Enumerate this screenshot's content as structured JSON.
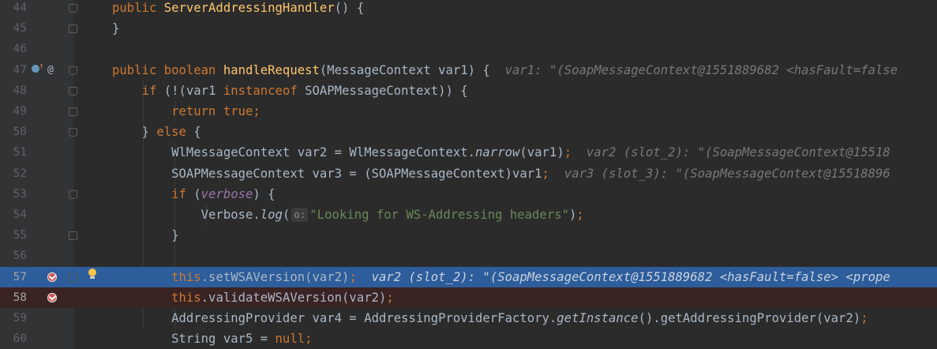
{
  "colors": {
    "background": "#2b2b2b",
    "gutter": "#313335",
    "execution_line": "#2d5d9a",
    "breakpoint_line": "#3a2323",
    "keyword": "#cc7832",
    "method": "#ffc66d",
    "string": "#6a8759",
    "field": "#9876aa"
  },
  "gutter_icons": {
    "override": "override-up-icon",
    "annotation": "at-sign-icon",
    "breakpoint": "breakpoint-check-icon",
    "intention": "lightbulb-icon"
  },
  "lines": [
    {
      "num": "44",
      "parts": [
        {
          "t": "public ",
          "c": "kw"
        },
        {
          "t": "ServerAddressingHandler",
          "c": "fn"
        },
        {
          "t": "() {"
        }
      ]
    },
    {
      "num": "45",
      "parts": [
        {
          "t": "}"
        }
      ]
    },
    {
      "num": "46",
      "parts": []
    },
    {
      "num": "47",
      "annot": "@",
      "parts": [
        {
          "t": "public ",
          "c": "kw"
        },
        {
          "t": "boolean ",
          "c": "kw"
        },
        {
          "t": "handleRequest",
          "c": "fn"
        },
        {
          "t": "(MessageContext var1) {  "
        },
        {
          "t": "var1: \"(SoapMessageContext@1551889682 <hasFault=false",
          "c": "inl"
        }
      ]
    },
    {
      "num": "48",
      "parts": [
        {
          "t": "    "
        },
        {
          "t": "if ",
          "c": "kw"
        },
        {
          "t": "(!(var1 "
        },
        {
          "t": "instanceof ",
          "c": "kw"
        },
        {
          "t": "SOAPMessageContext)) {"
        }
      ]
    },
    {
      "num": "49",
      "parts": [
        {
          "t": "        "
        },
        {
          "t": "return true;",
          "c": "kw"
        }
      ]
    },
    {
      "num": "50",
      "parts": [
        {
          "t": "    } "
        },
        {
          "t": "else ",
          "c": "kw"
        },
        {
          "t": "{"
        }
      ]
    },
    {
      "num": "51",
      "parts": [
        {
          "t": "        WlMessageContext var2 = WlMessageContext."
        },
        {
          "t": "narrow",
          "c": "it"
        },
        {
          "t": "(var1)"
        },
        {
          "t": ";",
          "c": "kw"
        },
        {
          "t": "  var2 (slot_2): \"(SoapMessageContext@15518",
          "c": "inl"
        }
      ]
    },
    {
      "num": "52",
      "parts": [
        {
          "t": "        SOAPMessageContext var3 = (SOAPMessageContext)var1"
        },
        {
          "t": ";",
          "c": "kw"
        },
        {
          "t": "  var3 (slot_3): \"(SoapMessageContext@15518896",
          "c": "inl"
        }
      ]
    },
    {
      "num": "53",
      "parts": [
        {
          "t": "        "
        },
        {
          "t": "if ",
          "c": "kw"
        },
        {
          "t": "("
        },
        {
          "t": "verbose",
          "c": "fld"
        },
        {
          "t": ") {"
        }
      ]
    },
    {
      "num": "54",
      "hint": "o:",
      "parts": [
        {
          "t": "            Verbose."
        },
        {
          "t": "log",
          "c": "it"
        },
        {
          "t": "("
        },
        {
          "hint": true
        },
        {
          "t": "\"Looking for WS-Addressing headers\"",
          "c": "str"
        },
        {
          "t": ")"
        },
        {
          "t": ";",
          "c": "kw"
        }
      ]
    },
    {
      "num": "55",
      "parts": [
        {
          "t": "        }"
        }
      ]
    },
    {
      "num": "56",
      "parts": []
    },
    {
      "num": "57",
      "state": "exec",
      "parts": [
        {
          "t": "        "
        },
        {
          "t": "this",
          "c": "kw"
        },
        {
          "t": ".setWSAVersion(var2)"
        },
        {
          "t": ";",
          "c": "kw"
        },
        {
          "t": "  var2 (slot_2): \"(SoapMessageContext@1551889682 <hasFault=false> <prope",
          "c": "inl"
        }
      ]
    },
    {
      "num": "58",
      "state": "bp",
      "parts": [
        {
          "t": "        "
        },
        {
          "t": "this",
          "c": "kw"
        },
        {
          "t": ".validateWSAVersion(var2)"
        },
        {
          "t": ";",
          "c": "kw"
        }
      ]
    },
    {
      "num": "59",
      "parts": [
        {
          "t": "        AddressingProvider var4 = AddressingProviderFactory."
        },
        {
          "t": "getInstance",
          "c": "it"
        },
        {
          "t": "().getAddressingProvider(var2)"
        },
        {
          "t": ";",
          "c": "kw"
        }
      ]
    },
    {
      "num": "60",
      "parts": [
        {
          "t": "        String var5 = "
        },
        {
          "t": "null;",
          "c": "kw"
        }
      ]
    }
  ]
}
